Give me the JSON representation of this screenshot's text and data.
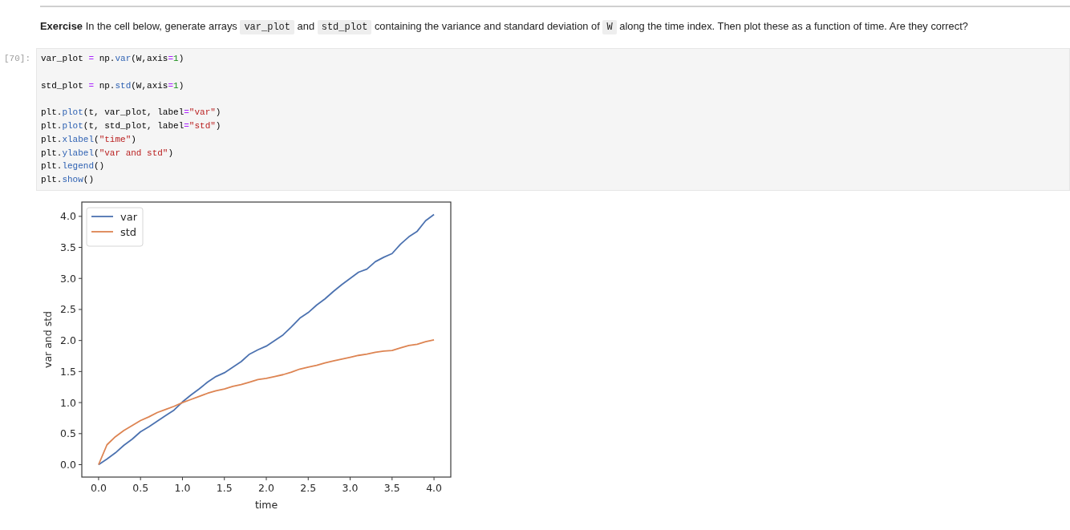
{
  "exercise": {
    "segments": [
      {
        "kind": "text",
        "text": "**Exercise** In the cell below, generate arrays"
      },
      {
        "kind": "code",
        "text": "var_plot"
      },
      {
        "kind": "text",
        "text": "and"
      },
      {
        "kind": "code",
        "text": "std_plot"
      },
      {
        "kind": "text",
        "text": "containing the variance and standard deviation of"
      },
      {
        "kind": "code",
        "text": "W"
      },
      {
        "kind": "text",
        "text": "along the time index. Then plot these as a function of time. Are they correct?"
      }
    ]
  },
  "code_cell": {
    "prompt": "[70]:",
    "blocks": [
      [
        [
          {
            "kind": "plain",
            "text": "var_plot "
          },
          {
            "kind": "op",
            "text": "="
          },
          {
            "kind": "plain",
            "text": " np."
          },
          {
            "kind": "attr",
            "text": "var"
          },
          {
            "kind": "plain",
            "text": "(W,axis"
          },
          {
            "kind": "op",
            "text": "="
          },
          {
            "kind": "num",
            "text": "1"
          },
          {
            "kind": "plain",
            "text": ")"
          }
        ]
      ],
      [
        [
          {
            "kind": "plain",
            "text": "std_plot "
          },
          {
            "kind": "op",
            "text": "="
          },
          {
            "kind": "plain",
            "text": " np."
          },
          {
            "kind": "attr",
            "text": "std"
          },
          {
            "kind": "plain",
            "text": "(W,axis"
          },
          {
            "kind": "op",
            "text": "="
          },
          {
            "kind": "num",
            "text": "1"
          },
          {
            "kind": "plain",
            "text": ")"
          }
        ]
      ],
      [
        [
          {
            "kind": "plain",
            "text": "plt."
          },
          {
            "kind": "attr",
            "text": "plot"
          },
          {
            "kind": "plain",
            "text": "(t, var_plot, label"
          },
          {
            "kind": "op",
            "text": "="
          },
          {
            "kind": "str",
            "text": "\"var\""
          },
          {
            "kind": "plain",
            "text": ")"
          }
        ],
        [
          {
            "kind": "plain",
            "text": "plt."
          },
          {
            "kind": "attr",
            "text": "plot"
          },
          {
            "kind": "plain",
            "text": "(t, std_plot, label"
          },
          {
            "kind": "op",
            "text": "="
          },
          {
            "kind": "str",
            "text": "\"std\""
          },
          {
            "kind": "plain",
            "text": ")"
          }
        ],
        [
          {
            "kind": "plain",
            "text": "plt."
          },
          {
            "kind": "attr",
            "text": "xlabel"
          },
          {
            "kind": "plain",
            "text": "("
          },
          {
            "kind": "str",
            "text": "\"time\""
          },
          {
            "kind": "plain",
            "text": ")"
          }
        ],
        [
          {
            "kind": "plain",
            "text": "plt."
          },
          {
            "kind": "attr",
            "text": "ylabel"
          },
          {
            "kind": "plain",
            "text": "("
          },
          {
            "kind": "str",
            "text": "\"var and std\""
          },
          {
            "kind": "plain",
            "text": ")"
          }
        ],
        [
          {
            "kind": "plain",
            "text": "plt."
          },
          {
            "kind": "attr",
            "text": "legend"
          },
          {
            "kind": "plain",
            "text": "()"
          }
        ],
        [
          {
            "kind": "plain",
            "text": "plt."
          },
          {
            "kind": "attr",
            "text": "show"
          },
          {
            "kind": "plain",
            "text": "()"
          }
        ]
      ]
    ]
  },
  "output": {
    "chart_data": {
      "type": "line",
      "xlabel": "time",
      "ylabel": "var and std",
      "x": [
        0,
        0.1,
        0.2,
        0.3,
        0.4,
        0.5,
        0.6,
        0.7,
        0.8,
        0.9,
        1,
        1.1,
        1.2,
        1.3,
        1.4,
        1.5,
        1.6,
        1.7,
        1.8,
        1.9,
        2,
        2.1,
        2.2,
        2.3,
        2.4,
        2.5,
        2.6,
        2.7,
        2.8,
        2.9,
        3,
        3.1,
        3.2,
        3.3,
        3.4,
        3.5,
        3.6,
        3.7,
        3.8,
        3.9,
        4
      ],
      "series": [
        {
          "name": "var",
          "color": "#4c72b0",
          "values": [
            0,
            0.09,
            0.19,
            0.31,
            0.41,
            0.53,
            0.61,
            0.7,
            0.79,
            0.88,
            1.01,
            1.12,
            1.22,
            1.33,
            1.42,
            1.48,
            1.57,
            1.66,
            1.78,
            1.85,
            1.91,
            2,
            2.09,
            2.22,
            2.36,
            2.45,
            2.57,
            2.67,
            2.79,
            2.9,
            3,
            3.1,
            3.15,
            3.27,
            3.34,
            3.4,
            3.55,
            3.67,
            3.76,
            3.93,
            4.03
          ]
        },
        {
          "name": "std",
          "color": "#dd8452",
          "values": [
            0,
            0.32,
            0.45,
            0.55,
            0.63,
            0.71,
            0.77,
            0.84,
            0.89,
            0.94,
            1,
            1.05,
            1.1,
            1.15,
            1.19,
            1.22,
            1.26,
            1.29,
            1.33,
            1.37,
            1.39,
            1.42,
            1.45,
            1.49,
            1.54,
            1.57,
            1.6,
            1.64,
            1.67,
            1.7,
            1.73,
            1.76,
            1.78,
            1.81,
            1.83,
            1.84,
            1.88,
            1.92,
            1.94,
            1.98,
            2.01
          ]
        }
      ],
      "xlim": [
        -0.2,
        4.2
      ],
      "ylim": [
        -0.2,
        4.23
      ],
      "xticks": [
        {
          "value": 0,
          "label": "0.0"
        },
        {
          "value": 0.5,
          "label": "0.5"
        },
        {
          "value": 1,
          "label": "1.0"
        },
        {
          "value": 1.5,
          "label": "1.5"
        },
        {
          "value": 2,
          "label": "2.0"
        },
        {
          "value": 2.5,
          "label": "2.5"
        },
        {
          "value": 3,
          "label": "3.0"
        },
        {
          "value": 3.5,
          "label": "3.5"
        },
        {
          "value": 4,
          "label": "4.0"
        }
      ],
      "yticks": [
        {
          "value": 0,
          "label": "0.0"
        },
        {
          "value": 0.5,
          "label": "0.5"
        },
        {
          "value": 1,
          "label": "1.0"
        },
        {
          "value": 1.5,
          "label": "1.5"
        },
        {
          "value": 2,
          "label": "2.0"
        },
        {
          "value": 2.5,
          "label": "2.5"
        },
        {
          "value": 3,
          "label": "3.0"
        },
        {
          "value": 3.5,
          "label": "3.5"
        },
        {
          "value": 4,
          "label": "4.0"
        }
      ],
      "legend": true
    }
  }
}
